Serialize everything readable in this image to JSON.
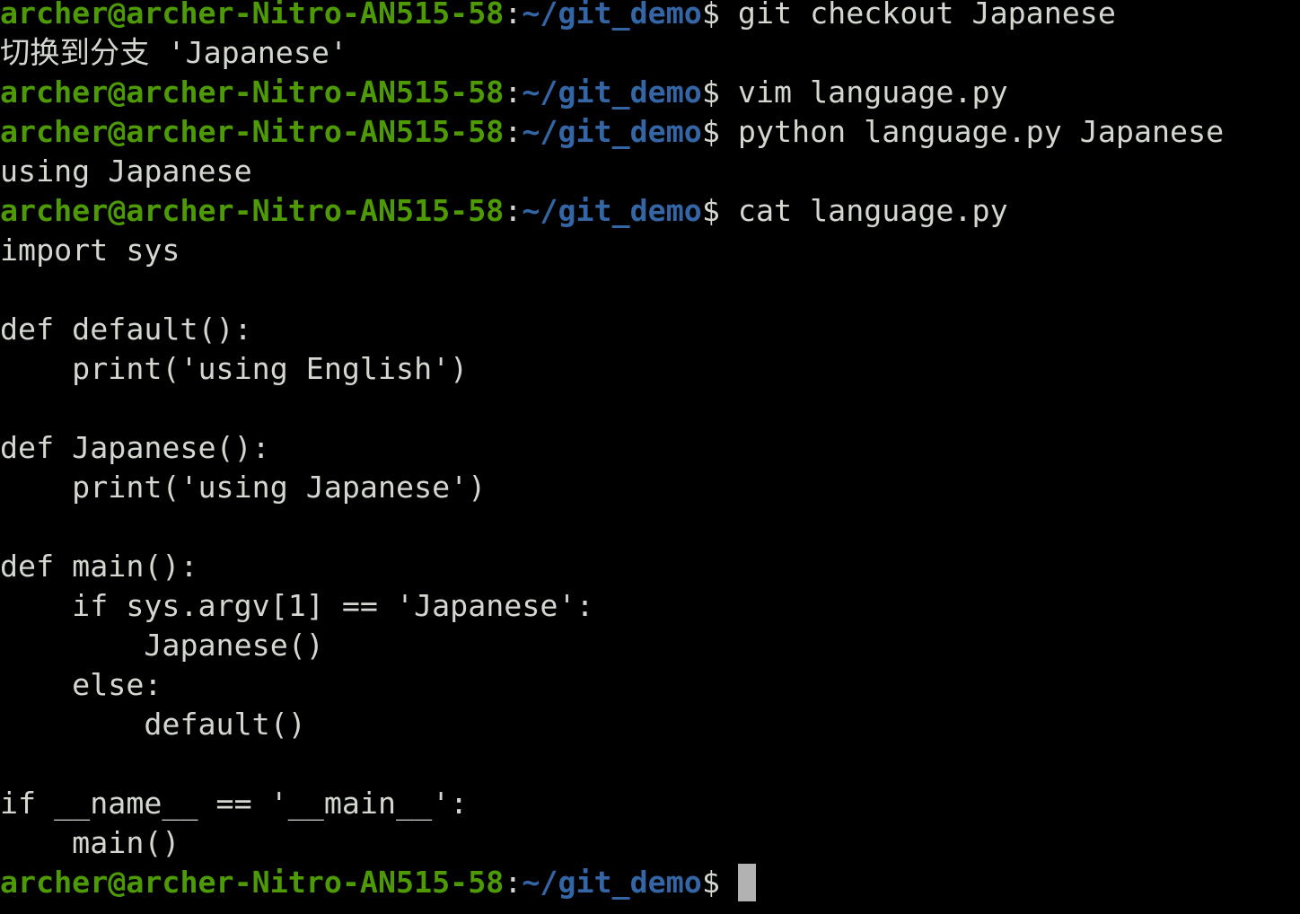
{
  "prompt": {
    "user_host": "archer@archer-Nitro-AN515-58",
    "colon": ":",
    "path": "~/git_demo",
    "dollar": "$ "
  },
  "lines": [
    {
      "type": "prompt",
      "cmd": "git checkout Japanese"
    },
    {
      "type": "output",
      "text": "切换到分支 'Japanese'"
    },
    {
      "type": "prompt",
      "cmd": "vim language.py"
    },
    {
      "type": "prompt",
      "cmd": "python language.py Japanese"
    },
    {
      "type": "output",
      "text": "using Japanese"
    },
    {
      "type": "prompt",
      "cmd": "cat language.py"
    },
    {
      "type": "output",
      "text": "import sys"
    },
    {
      "type": "output",
      "text": ""
    },
    {
      "type": "output",
      "text": "def default():"
    },
    {
      "type": "output",
      "text": "    print('using English')"
    },
    {
      "type": "output",
      "text": ""
    },
    {
      "type": "output",
      "text": "def Japanese():"
    },
    {
      "type": "output",
      "text": "    print('using Japanese')"
    },
    {
      "type": "output",
      "text": ""
    },
    {
      "type": "output",
      "text": "def main():"
    },
    {
      "type": "output",
      "text": "    if sys.argv[1] == 'Japanese':"
    },
    {
      "type": "output",
      "text": "        Japanese()"
    },
    {
      "type": "output",
      "text": "    else:"
    },
    {
      "type": "output",
      "text": "        default()"
    },
    {
      "type": "output",
      "text": ""
    },
    {
      "type": "output",
      "text": "if __name__ == '__main__':"
    },
    {
      "type": "output",
      "text": "    main()"
    },
    {
      "type": "prompt",
      "cmd": "",
      "cursor": true
    }
  ],
  "colors": {
    "background": "#000000",
    "foreground": "#d3d7cf",
    "user_host": "#4e9a06",
    "path": "#3465a4",
    "cursor": "#b2b2b2"
  }
}
